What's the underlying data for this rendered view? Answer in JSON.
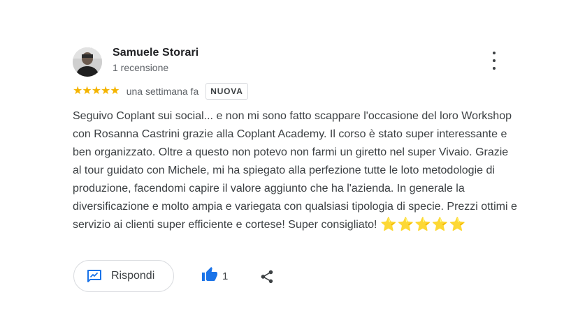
{
  "review": {
    "author": "Samuele Storari",
    "review_count": "1 recensione",
    "rating": 5,
    "stars": "★★★★★",
    "time_ago": "una settimana fa",
    "badge": "NUOVA",
    "text": "Seguivo Coplant sui social... e non mi sono fatto scappare l'occasione del loro Workshop con Rosanna Castrini grazie alla Coplant Academy. Il corso è stato super interessante e ben organizzato. Oltre a questo non potevo non farmi un giretto nel super Vivaio. Grazie al tour guidato con Michele, mi ha spiegato alla perfezione tutte le loto metodologie di produzione, facendomi capire il valore aggiunto che ha l'azienda. In generale la diversificazione e molto ampia e variegata con qualsiasi tipologia di specie. Prezzi ottimi e servizio ai clienti super efficiente e cortese! Super consigliato!",
    "emoji_stars": "⭐⭐⭐⭐⭐"
  },
  "actions": {
    "reply_label": "Rispondi",
    "like_count": "1"
  },
  "icons": {
    "more": "more-vert-icon",
    "reply": "reply-icon",
    "like": "thumb-up-icon",
    "share": "share-icon"
  },
  "colors": {
    "star": "#f4b400",
    "accent": "#1a73e8",
    "text": "#3c4043",
    "muted": "#5f6368"
  }
}
